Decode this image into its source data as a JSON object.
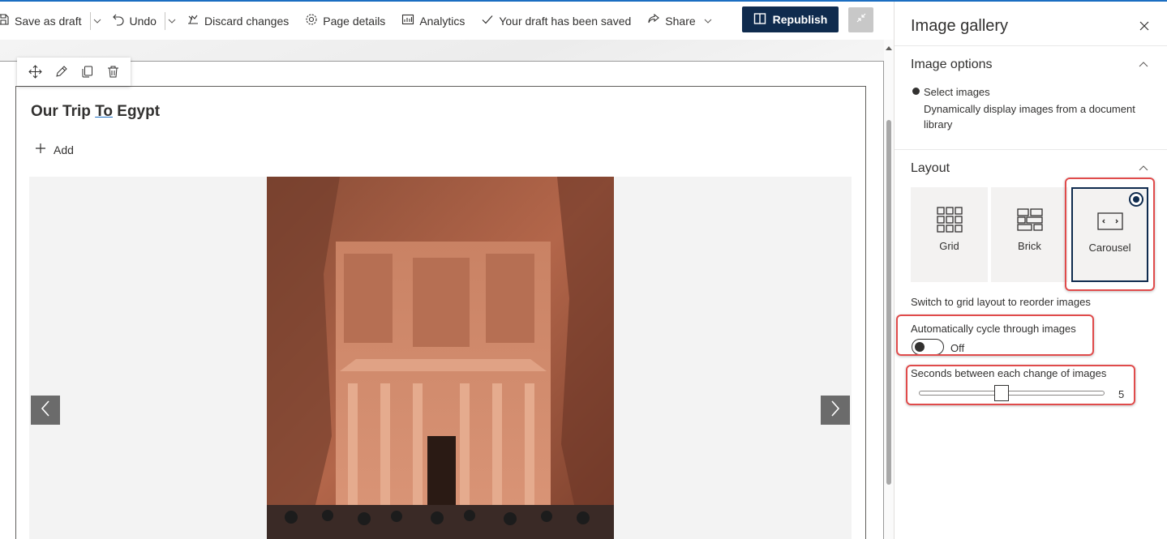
{
  "toolbar": {
    "save_draft": "Save as draft",
    "undo": "Undo",
    "discard": "Discard changes",
    "page_details": "Page details",
    "analytics": "Analytics",
    "draft_status": "Your draft has been saved",
    "share": "Share",
    "republish": "Republish"
  },
  "page": {
    "title_prefix": "Our Trip ",
    "title_link": "To",
    "title_suffix": " Egypt",
    "add": "Add"
  },
  "gallery": {
    "current_image": "photo-of-petra-treasury-facade"
  },
  "pane": {
    "title": "Image gallery",
    "image_options": {
      "header": "Image options",
      "radio_label": "Select images",
      "radio_desc": "Dynamically display images from a document library"
    },
    "layout": {
      "header": "Layout",
      "options": [
        "Grid",
        "Brick",
        "Carousel"
      ],
      "selected": "Carousel",
      "hint": "Switch to grid layout to reorder images"
    },
    "auto_cycle": {
      "label": "Automatically cycle through images",
      "state": "Off"
    },
    "seconds": {
      "label": "Seconds between each change of images",
      "value": 5,
      "min": 1,
      "max": 10
    }
  },
  "colors": {
    "accent_navy": "#0f2b4e",
    "highlight_red": "#e04b4b",
    "top_line_blue": "#1b6ec2"
  }
}
